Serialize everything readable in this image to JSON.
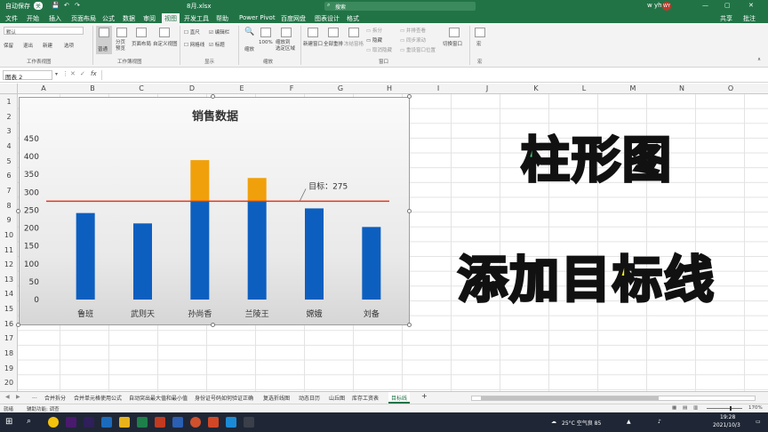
{
  "titlebar": {
    "autosave": "自动保存",
    "autosave_state": "关",
    "filename": "8月.xlsx",
    "search_placeholder": "搜索",
    "user": "w yh",
    "share": "共享",
    "comment": "批注"
  },
  "menu": {
    "tabs": [
      "文件",
      "开始",
      "插入",
      "页面布局",
      "公式",
      "数据",
      "审阅",
      "视图",
      "开发工具",
      "帮助",
      "Power Pivot",
      "百度网盘",
      "图表设计",
      "格式"
    ],
    "active_index": 7
  },
  "ribbon": {
    "workbook_view_label": "工作表视图",
    "workbook_views_label": "工作簿视图",
    "show_label": "显示",
    "zoom_label": "缩放",
    "window_label": "窗口",
    "macro_label": "宏",
    "default_label": "默认",
    "keep": "保留",
    "exit": "退出",
    "new": "新建",
    "options": "选项",
    "normal": "普通",
    "page_break": "分页\n预览",
    "page_layout": "页面布局",
    "custom_views": "自定义视图",
    "ruler": "直尺",
    "formula_bar": "编辑栏",
    "gridlines": "网格线",
    "headings": "标题",
    "zoom": "缩放",
    "zoom100": "100%",
    "zoom_sel": "缩放到\n选定区域",
    "new_window": "新建窗口",
    "arrange_all": "全部重排",
    "freeze": "冻结窗格",
    "split": "拆分",
    "hide": "隐藏",
    "unhide": "取消隐藏",
    "side_by_side": "并排查看",
    "sync_scroll": "同步滚动",
    "reset_pos": "重设窗口位置",
    "switch_windows": "切换窗口",
    "macros": "宏"
  },
  "formula_bar": {
    "name_box": "图表 2",
    "fx": "fx",
    "value": ""
  },
  "columns": [
    "A",
    "B",
    "C",
    "D",
    "E",
    "F",
    "G",
    "H",
    "I",
    "J",
    "K",
    "L",
    "M",
    "N",
    "O"
  ],
  "rows": [
    "1",
    "2",
    "3",
    "4",
    "5",
    "6",
    "7",
    "8",
    "9",
    "10",
    "11",
    "12",
    "13",
    "14",
    "15",
    "16",
    "17",
    "18",
    "19",
    "20"
  ],
  "chart_data": {
    "type": "bar",
    "title": "销售数据",
    "categories": [
      "鲁班",
      "武则天",
      "孙尚香",
      "兰陵王",
      "嫦娥",
      "刘备"
    ],
    "series": [
      {
        "values": [
          242,
          213,
          275,
          275,
          255,
          203
        ],
        "color": "#0d5fbf"
      },
      {
        "values": [
          0,
          0,
          115,
          65,
          0,
          0
        ],
        "color": "#f0a00a"
      }
    ],
    "target": {
      "value": 275,
      "label": "目标：275",
      "color": "#e03a1f"
    },
    "yticks": [
      0,
      50,
      100,
      150,
      200,
      250,
      300,
      350,
      400,
      450
    ],
    "ylim": [
      0,
      450
    ],
    "grid": false
  },
  "overlay": {
    "line1": "柱形图",
    "line2": "添加目标线"
  },
  "sheets": {
    "tabs": [
      "...",
      "合并拆分",
      "合并单元格使用公式",
      "自动突出最大值和最小值",
      "身份证号码如何验证正确",
      "复选折线图",
      "动态日历",
      "山丘图",
      "库存工资表",
      "目标线"
    ],
    "active_index": 9,
    "add": "+"
  },
  "status": {
    "ready": "就绪",
    "accessibility": "辅助功能: 调查",
    "zoom": "170%"
  },
  "taskbar": {
    "weather": "25°C 空气良 85",
    "time": "19:28",
    "date": "2021/10/3"
  }
}
